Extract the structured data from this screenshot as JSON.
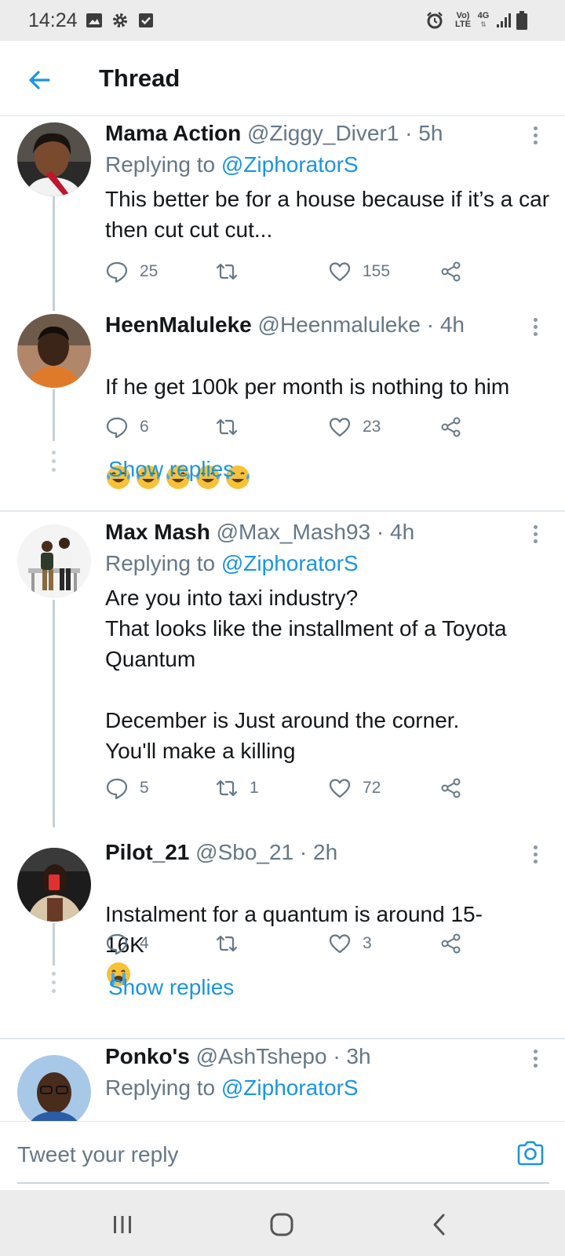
{
  "status_bar": {
    "time": "14:24",
    "volte_label": "Vo)",
    "lte_label": "LTE",
    "network_label": "4G",
    "icons": [
      "image-icon",
      "gear-icon",
      "checkbox-icon",
      "alarm-icon",
      "volte-icon",
      "network-4g-icon",
      "signal-icon",
      "battery-icon"
    ]
  },
  "header": {
    "title": "Thread",
    "back_icon": "arrow-left-icon"
  },
  "tweets": [
    {
      "name": "Mama Action",
      "handle": "@Ziggy_Diver1 · 5h",
      "replying_prefix": "Replying to ",
      "replying_to": "@ZiphoratorS",
      "text": "This better be for a house because if it’s a car then cut cut cut...",
      "replies": "25",
      "retweets": "",
      "likes": "155"
    },
    {
      "name": "HeenMaluleke",
      "handle": "@Heenmaluleke · 4h",
      "text": "If he get 100k per month is nothing to him",
      "emojis": [
        "tears-of-joy-emoji",
        "tears-of-joy-emoji",
        "tears-of-joy-emoji",
        "tears-of-joy-emoji",
        "tears-of-joy-emoji"
      ],
      "replies": "6",
      "retweets": "",
      "likes": "23",
      "show_replies": "Show replies"
    },
    {
      "name": "Max Mash",
      "handle": "@Max_Mash93 · 4h",
      "replying_prefix": "Replying to ",
      "replying_to": "@ZiphoratorS",
      "text": "Are you into taxi industry?\nThat looks like the installment of a Toyota Quantum\n\nDecember is Just around the corner.\nYou'll make a killing",
      "replies": "5",
      "retweets": "1",
      "likes": "72"
    },
    {
      "name": "Pilot_21",
      "handle": "@Sbo_21 · 2h",
      "text": "Instalment for a quantum is around 15-16K",
      "emojis": [
        "crying-face-emoji"
      ],
      "replies": "4",
      "retweets": "",
      "likes": "3",
      "show_replies": "Show replies"
    },
    {
      "name": "Ponko's",
      "handle": "@AshTshepo · 3h",
      "replying_prefix": "Replying to ",
      "replying_to": "@ZiphoratorS"
    }
  ],
  "reply_bar": {
    "placeholder": "Tweet your reply",
    "camera_icon": "camera-icon"
  },
  "nav_bar": {
    "icons": [
      "recent-apps-icon",
      "home-icon",
      "back-icon"
    ]
  },
  "colors": {
    "accent": "#1b95e0",
    "secondary_text": "#657786",
    "primary_text": "#14171a",
    "divider": "#e1e8ed",
    "system_bar": "#ececec"
  }
}
